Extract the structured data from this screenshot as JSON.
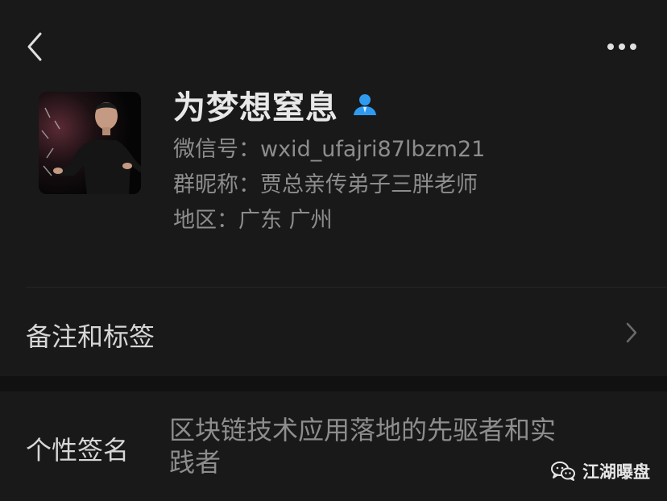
{
  "header": {
    "back_icon": "chevron-left-icon",
    "more_icon": "more-dots-icon"
  },
  "profile": {
    "name": "为梦想窒息",
    "gender_icon": "male-person-icon",
    "gender_color": "#2f9bf0",
    "wechat_id_label": "微信号：",
    "wechat_id": "wxid_ufajri87lbzm21",
    "group_nickname_label": "群昵称：",
    "group_nickname": "贾总亲传弟子三胖老师",
    "region_label": "地区：",
    "region": "广东 广州"
  },
  "remarks": {
    "label": "备注和标签",
    "chevron_icon": "chevron-right-icon"
  },
  "signature": {
    "label": "个性签名",
    "text": "区块链技术应用落地的先驱者和实践者"
  },
  "watermark": {
    "text": "江湖曝盘",
    "icon": "wechat-logo-icon"
  }
}
